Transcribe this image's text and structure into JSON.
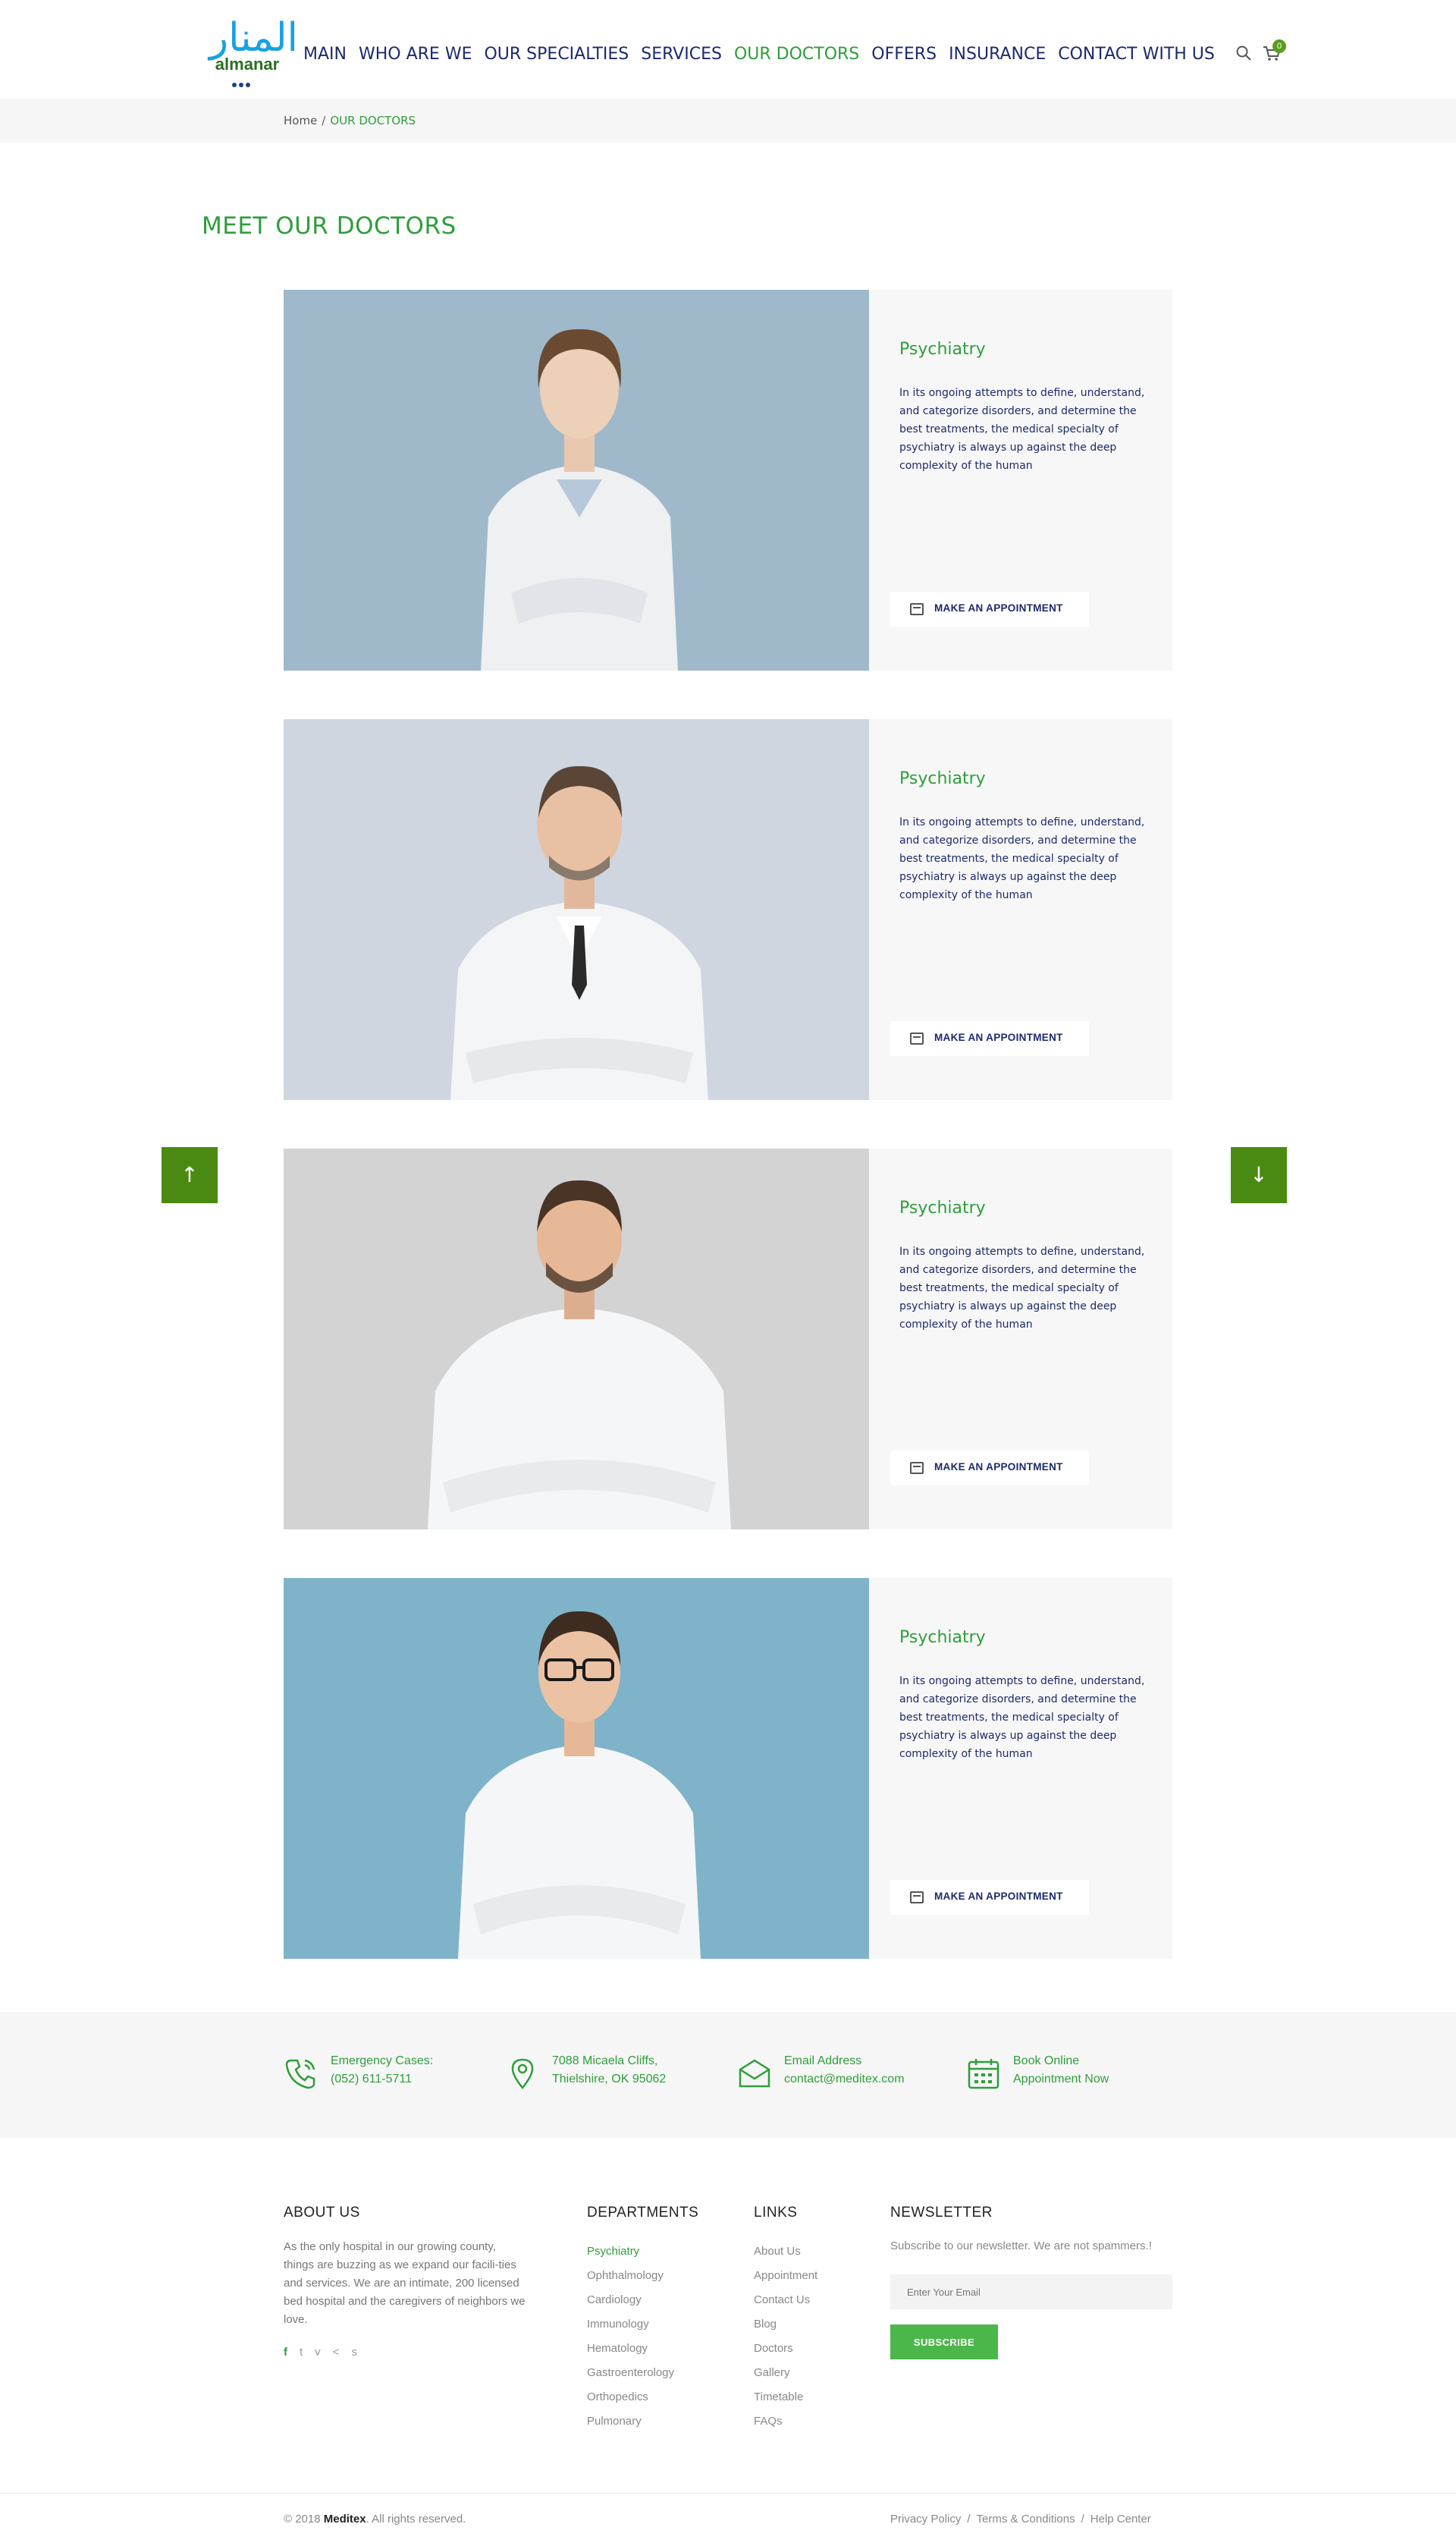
{
  "brand": {
    "arabic_name": "المنار",
    "latin_name": "almanar"
  },
  "nav": {
    "items": [
      "MAIN",
      "WHO ARE WE",
      "OUR SPECIALTIES",
      "SERVICES",
      "OUR DOCTORS",
      "OFFERS",
      "INSURANCE",
      "CONTACT WITH US"
    ],
    "active": "OUR DOCTORS",
    "cart_count": "0"
  },
  "breadcrumb": {
    "home": "Home",
    "separator": "/",
    "current": "OUR DOCTORS"
  },
  "page_title": "MEET OUR DOCTORS",
  "doctors": [
    {
      "specialty": "Psychiatry",
      "description": "In its ongoing attempts to define, understand, and categorize disorders, and determine the best treatments, the medical specialty of psychiatry is always up against the deep complexity of the human",
      "button": "MAKE AN APPOINTMENT",
      "photo_bg": "#9fb9cb"
    },
    {
      "specialty": "Psychiatry",
      "description": "In its ongoing attempts to define, understand, and categorize disorders, and determine the best treatments, the medical specialty of psychiatry is always up against the deep complexity of the human",
      "button": "MAKE AN APPOINTMENT",
      "photo_bg": "#cfd6e0"
    },
    {
      "specialty": "Psychiatry",
      "description": "In its ongoing attempts to define, understand, and categorize disorders, and determine the best treatments, the medical specialty of psychiatry is always up against the deep complexity of the human",
      "button": "MAKE AN APPOINTMENT",
      "photo_bg": "#d3d3d3"
    },
    {
      "specialty": "Psychiatry",
      "description": "In its ongoing attempts to define, understand, and categorize disorders, and determine the best treatments, the medical specialty of psychiatry is always up against the deep complexity of the human",
      "button": "MAKE AN APPOINTMENT",
      "photo_bg": "#7fb3c9"
    }
  ],
  "scroll_buttons": {
    "up": "↑",
    "down": "↓"
  },
  "contact": [
    {
      "label": "Emergency Cases:",
      "value": "(052) 611-5711",
      "icon": "phone-icon"
    },
    {
      "label": "7088 Micaela Cliffs,",
      "value": "Thielshire, OK 95062",
      "icon": "location-pin-icon"
    },
    {
      "label": "Email Address",
      "value": "contact@meditex.com",
      "icon": "envelope-icon"
    },
    {
      "label": "Book Online",
      "value": "Appointment Now",
      "icon": "calendar-icon"
    }
  ],
  "footer": {
    "about": {
      "heading": "ABOUT US",
      "text": "As the only hospital in our growing county, things are buzzing as we expand our facili-ties and services. We are an intimate, 200 licensed bed hospital and the caregivers of neighbors we love."
    },
    "socials": [
      "f",
      "t",
      "v",
      "share",
      "s"
    ],
    "departments": {
      "heading": "DEPARTMENTS",
      "items": [
        "Psychiatry",
        "Ophthalmology",
        "Cardiology",
        "Immunology",
        "Hematology",
        "Gastroenterology",
        "Orthopedics",
        "Pulmonary"
      ]
    },
    "links": {
      "heading": "LINKS",
      "items": [
        "About Us",
        "Appointment",
        "Contact Us",
        "Blog",
        "Doctors",
        "Gallery",
        "Timetable",
        "FAQs"
      ]
    },
    "newsletter": {
      "heading": "NEWSLETTER",
      "text": "Subscribe to our newsletter. We are not spammers.!",
      "placeholder": "Enter Your Email",
      "button": "SUBSCRIBE"
    },
    "copyright_prefix": "© 2018",
    "copyright_brand": "Meditex",
    "copyright_suffix": ". All rights reserved.",
    "legal": [
      "Privacy Policy",
      "Terms & Conditions",
      "Help Center"
    ]
  },
  "colors": {
    "accent_green": "#2e9e3a",
    "nav_blue": "#1c2a6b",
    "button_green": "#4a8a12"
  }
}
